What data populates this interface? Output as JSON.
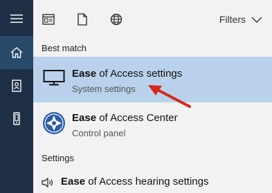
{
  "rail": {
    "items": [
      {
        "name": "menu",
        "icon": "hamburger-icon"
      },
      {
        "name": "home",
        "icon": "home-icon",
        "active": true
      },
      {
        "name": "notebook",
        "icon": "notebook-icon"
      },
      {
        "name": "device",
        "icon": "device-icon"
      }
    ]
  },
  "topbar": {
    "apps_icon": "apps-icon",
    "documents_icon": "document-icon",
    "web_icon": "globe-icon",
    "filters_label": "Filters"
  },
  "sections": {
    "best_match": "Best match",
    "settings": "Settings"
  },
  "results": {
    "best": {
      "title_bold": "Ease",
      "title_rest": " of Access settings",
      "subtitle": "System settings",
      "icon": "monitor-icon"
    },
    "center": {
      "title_bold": "Ease",
      "title_rest": " of Access Center",
      "subtitle": "Control panel",
      "icon": "ease-of-access-icon"
    },
    "hearing": {
      "title_bold": "Ease",
      "title_rest": " of Access hearing settings",
      "icon": "speaker-icon"
    }
  },
  "colors": {
    "rail_bg": "#1f2f45",
    "rail_active": "#2a4a6c",
    "selected_bg": "#b9d1ea",
    "arrow": "#d7261e"
  }
}
